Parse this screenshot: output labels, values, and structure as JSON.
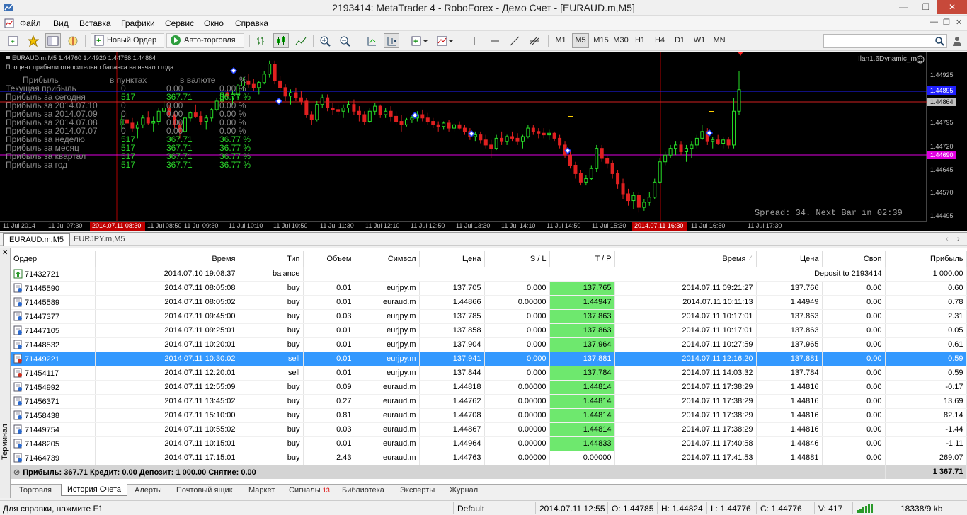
{
  "window": {
    "title": "2193414: MetaTrader 4 - RoboForex - Демо Счет - [EURAUD.m,M5]"
  },
  "menu": [
    "Файл",
    "Вид",
    "Вставка",
    "Графики",
    "Сервис",
    "Окно",
    "Справка"
  ],
  "toolbar": {
    "new_order": "Новый Ордер",
    "autotrading": "Авто-торговля",
    "timeframes": [
      "M1",
      "M5",
      "M15",
      "M30",
      "H1",
      "H4",
      "D1",
      "W1",
      "MN"
    ],
    "active_timeframe": "M5"
  },
  "chart": {
    "header": "EURAUD.m,M5  1.44760 1.44920 1.44758 1.44864",
    "subtitle": "Процент прибыли относительно баланса на начало года",
    "indicator": "Ilan1.6Dynamic_m",
    "spread": "Spread: 34. Next Bar in 02:39",
    "price_ticks": [
      "1.44925",
      "1.44895",
      "1.44864",
      "1.44795",
      "1.44720",
      "1.44690",
      "1.44645",
      "1.44570",
      "1.44495"
    ],
    "bid_label": "1.44864",
    "blue_label": "1.44895",
    "magenta_label": "1.44690",
    "time_ticks": [
      "11 Jul 2014",
      "11 Jul 07:30",
      "2014.07.11 08:30",
      "11 Jul 08:50",
      "11 Jul 09:30",
      "11 Jul 10:10",
      "11 Jul 10:50",
      "11 Jul 11:30",
      "11 Jul 12:10",
      "11 Jul 12:50",
      "11 Jul 13:30",
      "11 Jul 14:10",
      "11 Jul 14:50",
      "11 Jul 15:30",
      "2014.07.11 16:30",
      "11 Jul 16:50",
      "11 Jul 17:30"
    ],
    "profit_table": {
      "headers": [
        "Прибыль",
        "в пунктах",
        "в валюте",
        "%"
      ],
      "rows": [
        [
          "Текущая прибыль",
          "0",
          "0.00",
          "0.00 %"
        ],
        [
          "Прибыль за сегодня",
          "517",
          "367.71",
          "36.77 %"
        ],
        [
          "Прибыль за 2014.07.10",
          "0",
          "0.00",
          "0.00 %"
        ],
        [
          "Прибыль за 2014.07.09",
          "0",
          "0.00",
          "0.00 %"
        ],
        [
          "Прибыль за 2014.07.08",
          "0",
          "0.00",
          "0.00 %"
        ],
        [
          "Прибыль за 2014.07.07",
          "0",
          "0.00",
          "0.00 %"
        ],
        [
          "Прибыль за неделю",
          "517",
          "367.71",
          "36.77 %"
        ],
        [
          "Прибыль за месяц",
          "517",
          "367.71",
          "36.77 %"
        ],
        [
          "Прибыль за квартал",
          "517",
          "367.71",
          "36.77 %"
        ],
        [
          "Прибыль за год",
          "517",
          "367.71",
          "36.77 %"
        ]
      ]
    }
  },
  "chart_tabs": [
    "EURAUD.m,M5",
    "EURJPY.m,M5"
  ],
  "terminal": {
    "side_label": "Терминал",
    "columns": [
      "Ордер",
      "Время",
      "Тип",
      "Объем",
      "Символ",
      "Цена",
      "S / L",
      "T / P",
      "Время",
      "Цена",
      "Своп",
      "Прибыль"
    ],
    "balance_row": {
      "order": "71432721",
      "time": "2014.07.10 19:08:37",
      "type": "balance",
      "comment": "Deposit to 2193414",
      "profit": "1 000.00"
    },
    "rows": [
      {
        "order": "71445590",
        "time": "2014.07.11 08:05:08",
        "type": "buy",
        "volume": "0.01",
        "symbol": "eurjpy.m",
        "price": "137.705",
        "sl": "0.000",
        "tp": "137.765",
        "tp_hit": true,
        "ctime": "2014.07.11 09:21:27",
        "cprice": "137.766",
        "swap": "0.00",
        "profit": "0.60"
      },
      {
        "order": "71445589",
        "time": "2014.07.11 08:05:02",
        "type": "buy",
        "volume": "0.01",
        "symbol": "euraud.m",
        "price": "1.44866",
        "sl": "0.00000",
        "tp": "1.44947",
        "tp_hit": true,
        "ctime": "2014.07.11 10:11:13",
        "cprice": "1.44949",
        "swap": "0.00",
        "profit": "0.78"
      },
      {
        "order": "71447377",
        "time": "2014.07.11 09:45:00",
        "type": "buy",
        "volume": "0.03",
        "symbol": "eurjpy.m",
        "price": "137.785",
        "sl": "0.000",
        "tp": "137.863",
        "tp_hit": true,
        "ctime": "2014.07.11 10:17:01",
        "cprice": "137.863",
        "swap": "0.00",
        "profit": "2.31"
      },
      {
        "order": "71447105",
        "time": "2014.07.11 09:25:01",
        "type": "buy",
        "volume": "0.01",
        "symbol": "eurjpy.m",
        "price": "137.858",
        "sl": "0.000",
        "tp": "137.863",
        "tp_hit": true,
        "ctime": "2014.07.11 10:17:01",
        "cprice": "137.863",
        "swap": "0.00",
        "profit": "0.05"
      },
      {
        "order": "71448532",
        "time": "2014.07.11 10:20:01",
        "type": "buy",
        "volume": "0.01",
        "symbol": "eurjpy.m",
        "price": "137.904",
        "sl": "0.000",
        "tp": "137.964",
        "tp_hit": true,
        "ctime": "2014.07.11 10:27:59",
        "cprice": "137.965",
        "swap": "0.00",
        "profit": "0.61"
      },
      {
        "order": "71449221",
        "time": "2014.07.11 10:30:02",
        "type": "sell",
        "volume": "0.01",
        "symbol": "eurjpy.m",
        "price": "137.941",
        "sl": "0.000",
        "tp": "137.881",
        "tp_hit": true,
        "ctime": "2014.07.11 12:16:20",
        "cprice": "137.881",
        "swap": "0.00",
        "profit": "0.59",
        "selected": true
      },
      {
        "order": "71454117",
        "time": "2014.07.11 12:20:01",
        "type": "sell",
        "volume": "0.01",
        "symbol": "eurjpy.m",
        "price": "137.844",
        "sl": "0.000",
        "tp": "137.784",
        "tp_hit": true,
        "ctime": "2014.07.11 14:03:32",
        "cprice": "137.784",
        "swap": "0.00",
        "profit": "0.59"
      },
      {
        "order": "71454992",
        "time": "2014.07.11 12:55:09",
        "type": "buy",
        "volume": "0.09",
        "symbol": "euraud.m",
        "price": "1.44818",
        "sl": "0.00000",
        "tp": "1.44814",
        "tp_hit": true,
        "ctime": "2014.07.11 17:38:29",
        "cprice": "1.44816",
        "swap": "0.00",
        "profit": "-0.17"
      },
      {
        "order": "71456371",
        "time": "2014.07.11 13:45:02",
        "type": "buy",
        "volume": "0.27",
        "symbol": "euraud.m",
        "price": "1.44762",
        "sl": "0.00000",
        "tp": "1.44814",
        "tp_hit": true,
        "ctime": "2014.07.11 17:38:29",
        "cprice": "1.44816",
        "swap": "0.00",
        "profit": "13.69"
      },
      {
        "order": "71458438",
        "time": "2014.07.11 15:10:00",
        "type": "buy",
        "volume": "0.81",
        "symbol": "euraud.m",
        "price": "1.44708",
        "sl": "0.00000",
        "tp": "1.44814",
        "tp_hit": true,
        "ctime": "2014.07.11 17:38:29",
        "cprice": "1.44816",
        "swap": "0.00",
        "profit": "82.14"
      },
      {
        "order": "71449754",
        "time": "2014.07.11 10:55:02",
        "type": "buy",
        "volume": "0.03",
        "symbol": "euraud.m",
        "price": "1.44867",
        "sl": "0.00000",
        "tp": "1.44814",
        "tp_hit": true,
        "ctime": "2014.07.11 17:38:29",
        "cprice": "1.44816",
        "swap": "0.00",
        "profit": "-1.44"
      },
      {
        "order": "71448205",
        "time": "2014.07.11 10:15:01",
        "type": "buy",
        "volume": "0.01",
        "symbol": "euraud.m",
        "price": "1.44964",
        "sl": "0.00000",
        "tp": "1.44833",
        "tp_hit": true,
        "ctime": "2014.07.11 17:40:58",
        "cprice": "1.44846",
        "swap": "0.00",
        "profit": "-1.11"
      },
      {
        "order": "71464739",
        "time": "2014.07.11 17:15:01",
        "type": "buy",
        "volume": "2.43",
        "symbol": "euraud.m",
        "price": "1.44763",
        "sl": "0.00000",
        "tp": "0.00000",
        "tp_hit": false,
        "ctime": "2014.07.11 17:41:53",
        "cprice": "1.44881",
        "swap": "0.00",
        "profit": "269.07"
      }
    ],
    "total": {
      "summary": "Прибыль: 367.71  Кредит: 0.00  Депозит: 1 000.00  Снятие: 0.00",
      "profit": "1 367.71"
    },
    "tabs": [
      "Торговля",
      "История Счета",
      "Алерты",
      "Почтовый ящик",
      "Маркет",
      "Сигналы",
      "Библиотека",
      "Эксперты",
      "Журнал"
    ],
    "signals_badge": "13",
    "active_tab": "История Счета"
  },
  "status": {
    "help": "Для справки, нажмите F1",
    "profile": "Default",
    "time": "2014.07.11 12:55",
    "o": "O: 1.44785",
    "h": "H: 1.44824",
    "l": "L: 1.44776",
    "c": "C: 1.44776",
    "v": "V: 417",
    "traffic": "18338/9 kb"
  },
  "candles": [
    [
      1.4476,
      1.4479,
      1.4474,
      1.44775
    ],
    [
      1.44775,
      1.448,
      1.4476,
      1.44765
    ],
    [
      1.44765,
      1.4478,
      1.4474,
      1.4475
    ],
    [
      1.4475,
      1.4477,
      1.4472,
      1.4476
    ],
    [
      1.4476,
      1.4479,
      1.4475,
      1.4478
    ],
    [
      1.4478,
      1.448,
      1.4476,
      1.44765
    ],
    [
      1.44765,
      1.44785,
      1.4474,
      1.4477
    ],
    [
      1.4477,
      1.4481,
      1.4476,
      1.448
    ],
    [
      1.448,
      1.4483,
      1.4479,
      1.4481
    ],
    [
      1.4481,
      1.4482,
      1.4478,
      1.4479
    ],
    [
      1.4479,
      1.448,
      1.4475,
      1.4476
    ],
    [
      1.4476,
      1.4477,
      1.4472,
      1.4474
    ],
    [
      1.4474,
      1.4479,
      1.4473,
      1.4478
    ],
    [
      1.4478,
      1.448,
      1.4477,
      1.44795
    ],
    [
      1.44795,
      1.4482,
      1.4478,
      1.44785
    ],
    [
      1.44785,
      1.448,
      1.4476,
      1.4477
    ],
    [
      1.4477,
      1.4479,
      1.44745,
      1.4478
    ],
    [
      1.4478,
      1.4481,
      1.4477,
      1.44805
    ],
    [
      1.44805,
      1.4484,
      1.448,
      1.4483
    ],
    [
      1.4483,
      1.4486,
      1.4482,
      1.44855
    ],
    [
      1.44855,
      1.4487,
      1.4484,
      1.44845
    ],
    [
      1.44845,
      1.4486,
      1.4482,
      1.4485
    ],
    [
      1.4485,
      1.4488,
      1.4484,
      1.44875
    ],
    [
      1.44875,
      1.449,
      1.4486,
      1.4489
    ],
    [
      1.4489,
      1.4491,
      1.4487,
      1.4488
    ],
    [
      1.4488,
      1.44895,
      1.4486,
      1.4487
    ],
    [
      1.4487,
      1.4489,
      1.4485,
      1.44885
    ],
    [
      1.44885,
      1.4492,
      1.4488,
      1.4491
    ],
    [
      1.4491,
      1.4495,
      1.449,
      1.4494
    ],
    [
      1.4494,
      1.4495,
      1.4488,
      1.4489
    ],
    [
      1.4489,
      1.44905,
      1.4486,
      1.4487
    ],
    [
      1.4487,
      1.4488,
      1.4483,
      1.44845
    ],
    [
      1.44845,
      1.44865,
      1.4482,
      1.44855
    ],
    [
      1.44855,
      1.4487,
      1.4483,
      1.4484
    ],
    [
      1.4484,
      1.4486,
      1.4482,
      1.4483
    ],
    [
      1.4483,
      1.4484,
      1.4478,
      1.4479
    ],
    [
      1.4479,
      1.448,
      1.4476,
      1.44775
    ],
    [
      1.44775,
      1.4483,
      1.4477,
      1.4482
    ],
    [
      1.4482,
      1.4485,
      1.4481,
      1.4484
    ],
    [
      1.4484,
      1.4485,
      1.448,
      1.4481
    ],
    [
      1.4481,
      1.44825,
      1.4479,
      1.44805
    ],
    [
      1.44805,
      1.4482,
      1.4479,
      1.448
    ],
    [
      1.448,
      1.4482,
      1.4478,
      1.4481
    ],
    [
      1.4481,
      1.4483,
      1.44795,
      1.4482
    ],
    [
      1.4482,
      1.44835,
      1.4479,
      1.448
    ],
    [
      1.448,
      1.44815,
      1.4477,
      1.4479
    ],
    [
      1.4479,
      1.448,
      1.4476,
      1.4477
    ],
    [
      1.4477,
      1.4481,
      1.44765,
      1.448
    ],
    [
      1.448,
      1.44825,
      1.4479,
      1.44815
    ],
    [
      1.44815,
      1.4482,
      1.4478,
      1.4479
    ],
    [
      1.4479,
      1.4481,
      1.4478,
      1.448
    ],
    [
      1.448,
      1.44815,
      1.4477,
      1.44785
    ],
    [
      1.44785,
      1.448,
      1.4476,
      1.4477
    ],
    [
      1.4477,
      1.4479,
      1.4474,
      1.4476
    ],
    [
      1.4476,
      1.4478,
      1.44755,
      1.44775
    ],
    [
      1.44775,
      1.4479,
      1.44765,
      1.4478
    ],
    [
      1.4478,
      1.448,
      1.4477,
      1.4479
    ],
    [
      1.4479,
      1.44805,
      1.4477,
      1.4478
    ],
    [
      1.4478,
      1.44795,
      1.4476,
      1.4477
    ],
    [
      1.4477,
      1.4478,
      1.4475,
      1.4476
    ],
    [
      1.4476,
      1.4477,
      1.4474,
      1.44755
    ],
    [
      1.44755,
      1.4477,
      1.44745,
      1.44765
    ],
    [
      1.44765,
      1.44775,
      1.4474,
      1.4475
    ],
    [
      1.4475,
      1.44765,
      1.4474,
      1.4476
    ],
    [
      1.4476,
      1.4477,
      1.44745,
      1.4475
    ],
    [
      1.4475,
      1.4476,
      1.4473,
      1.4474
    ],
    [
      1.4474,
      1.4475,
      1.44715,
      1.44725
    ],
    [
      1.44725,
      1.4474,
      1.4471,
      1.4473
    ],
    [
      1.4473,
      1.4474,
      1.44705,
      1.44715
    ],
    [
      1.44715,
      1.4473,
      1.4469,
      1.447
    ],
    [
      1.447,
      1.44715,
      1.4466,
      1.4469
    ],
    [
      1.4469,
      1.4473,
      1.44685,
      1.4472
    ],
    [
      1.4472,
      1.4474,
      1.447,
      1.4471
    ],
    [
      1.4471,
      1.4473,
      1.447,
      1.44725
    ],
    [
      1.44725,
      1.4474,
      1.4471,
      1.4472
    ],
    [
      1.4472,
      1.44735,
      1.447,
      1.4471
    ],
    [
      1.4471,
      1.4473,
      1.4469,
      1.44725
    ],
    [
      1.44725,
      1.4476,
      1.4472,
      1.4475
    ],
    [
      1.4475,
      1.4476,
      1.4473,
      1.4474
    ],
    [
      1.4474,
      1.4475,
      1.4472,
      1.44735
    ],
    [
      1.44735,
      1.4475,
      1.4472,
      1.4473
    ],
    [
      1.4473,
      1.44745,
      1.44715,
      1.44735
    ],
    [
      1.44735,
      1.4474,
      1.4471,
      1.4472
    ],
    [
      1.4472,
      1.4473,
      1.4469,
      1.447
    ],
    [
      1.447,
      1.4471,
      1.4466,
      1.4467
    ],
    [
      1.4467,
      1.44685,
      1.4463,
      1.4464
    ],
    [
      1.4464,
      1.4465,
      1.446,
      1.44615
    ],
    [
      1.44615,
      1.44625,
      1.4458,
      1.4459
    ],
    [
      1.4459,
      1.4461,
      1.4458,
      1.446
    ],
    [
      1.446,
      1.4464,
      1.44595,
      1.4463
    ],
    [
      1.4463,
      1.447,
      1.4462,
      1.4469
    ],
    [
      1.4469,
      1.447,
      1.4465,
      1.4466
    ],
    [
      1.4466,
      1.4467,
      1.4463,
      1.44645
    ],
    [
      1.44645,
      1.44655,
      1.446,
      1.44615
    ],
    [
      1.44615,
      1.44625,
      1.4457,
      1.44585
    ],
    [
      1.44585,
      1.446,
      1.4454,
      1.44555
    ],
    [
      1.44555,
      1.4457,
      1.4452,
      1.44535
    ],
    [
      1.44535,
      1.4456,
      1.4451,
      1.4455
    ],
    [
      1.4455,
      1.4456,
      1.445,
      1.44515
    ],
    [
      1.44515,
      1.4454,
      1.44505,
      1.4453
    ],
    [
      1.4453,
      1.4456,
      1.4452,
      1.44545
    ],
    [
      1.44545,
      1.446,
      1.4454,
      1.4459
    ],
    [
      1.4459,
      1.4466,
      1.44585,
      1.4465
    ],
    [
      1.4465,
      1.4468,
      1.4464,
      1.4467
    ],
    [
      1.4467,
      1.447,
      1.4466,
      1.4469
    ],
    [
      1.4469,
      1.4471,
      1.4467,
      1.447
    ],
    [
      1.447,
      1.4471,
      1.4467,
      1.4468
    ],
    [
      1.4468,
      1.447,
      1.4465,
      1.4469
    ],
    [
      1.4469,
      1.4471,
      1.4466,
      1.447
    ],
    [
      1.447,
      1.4473,
      1.4469,
      1.4472
    ],
    [
      1.4472,
      1.4476,
      1.44715,
      1.4474
    ],
    [
      1.4474,
      1.4475,
      1.447,
      1.4471
    ],
    [
      1.4471,
      1.44725,
      1.4469,
      1.44715
    ],
    [
      1.44715,
      1.4473,
      1.447,
      1.44705
    ],
    [
      1.44705,
      1.44725,
      1.4469,
      1.44715
    ],
    [
      1.44715,
      1.44725,
      1.4469,
      1.447
    ],
    [
      1.447,
      1.4484,
      1.4469,
      1.448
    ],
    [
      1.448,
      1.4492,
      1.4479,
      1.44864
    ]
  ]
}
